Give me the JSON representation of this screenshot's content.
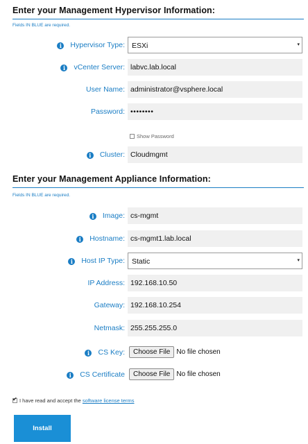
{
  "hypervisor_section": {
    "title": "Enter your Management Hypervisor Information:",
    "required_note": "Fields IN BLUE are required.",
    "fields": [
      {
        "label": "Hypervisor Type:",
        "value": "ESXi",
        "kind": "select",
        "info": true
      },
      {
        "label": "vCenter Server:",
        "value": "labvc.lab.local",
        "kind": "text",
        "info": true
      },
      {
        "label": "User Name:",
        "value": "administrator@vsphere.local",
        "kind": "text",
        "info": false
      },
      {
        "label": "Password:",
        "value": "••••••••",
        "kind": "password",
        "info": false
      }
    ],
    "show_password_label": "Show Password",
    "cluster": {
      "label": "Cluster:",
      "value": "Cloudmgmt",
      "info": true
    }
  },
  "appliance_section": {
    "title": "Enter your Management Appliance Information:",
    "required_note": "Fields IN BLUE are required.",
    "fields": [
      {
        "label": "Image:",
        "value": "cs-mgmt",
        "kind": "text",
        "info": true
      },
      {
        "label": "Hostname:",
        "value": "cs-mgmt1.lab.local",
        "kind": "text",
        "info": true
      },
      {
        "label": "Host IP Type:",
        "value": "Static",
        "kind": "select",
        "info": true
      },
      {
        "label": "IP Address:",
        "value": "192.168.10.50",
        "kind": "text",
        "info": false
      },
      {
        "label": "Gateway:",
        "value": "192.168.10.254",
        "kind": "text",
        "info": false
      },
      {
        "label": "Netmask:",
        "value": "255.255.255.0",
        "kind": "text",
        "info": false
      }
    ],
    "file_fields": [
      {
        "label": "CS Key:",
        "button": "Choose File",
        "status": "No file chosen",
        "info": true
      },
      {
        "label": "CS Certificate",
        "button": "Choose File",
        "status": "No file chosen",
        "info": true
      }
    ]
  },
  "license": {
    "text": "I have read and accept the ",
    "link": "software license terms",
    "checked": true
  },
  "install_button": "Install",
  "icons": {
    "info": "info-icon",
    "caret": "caret-down-icon",
    "checkbox": "checkbox-icon"
  },
  "colors": {
    "accent": "#1a7dc4",
    "button": "#1a8fd6",
    "field_bg": "#f0f0f0"
  }
}
